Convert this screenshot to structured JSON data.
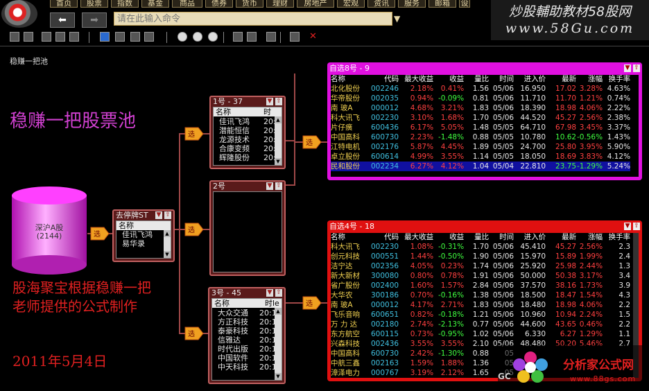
{
  "menubar": {
    "items": [
      "首页",
      "股票",
      "指数",
      "基金",
      "商品",
      "债券",
      "货币",
      "理财",
      "房地产",
      "宏观",
      "资讯",
      "服务",
      "邮箱",
      "设"
    ]
  },
  "nav": {
    "back_glyph": "⬅",
    "forward_glyph": "➡"
  },
  "command": {
    "placeholder": "请在此输入命令",
    "dropdown_glyph": "▼"
  },
  "brand": {
    "line1": "炒股輔助教材58股网",
    "line2": "www.58Gu.com"
  },
  "toolbar": {
    "icons": [
      "open-folder-icon",
      "folder-icon",
      "save-icon",
      "save-as-icon",
      "print-icon",
      "layout1-icon",
      "layout2-icon",
      "layout3-icon",
      "layout4-icon",
      "step-icon",
      "pause-icon",
      "stop-icon",
      "tool1-icon",
      "tool2-icon",
      "tool3-icon",
      "image-icon",
      "close-icon"
    ]
  },
  "canvas": {
    "title": "稳赚一把池",
    "heading": "稳赚一把股票池",
    "description": "股海聚宝根据稳赚一把老师提供的公式制作",
    "date": "2011年5月4日"
  },
  "source": {
    "line1": "深沪A股",
    "line2": "(2144)"
  },
  "filter_glyph": "选",
  "pool_filter": {
    "title": "去停牌ST",
    "column": "名称",
    "rows": [
      "佳讯飞鸿",
      "易华录"
    ]
  },
  "pool1": {
    "title": "1号 - 37",
    "column": "名称",
    "col2": "时",
    "rows": [
      [
        "佳讯飞鸿",
        "20:"
      ],
      [
        "潜能恒信",
        "20:"
      ],
      [
        "龙源技术",
        "20:"
      ],
      [
        "合康变频",
        "20:"
      ],
      [
        "辉隆股份",
        "20:"
      ]
    ]
  },
  "pool2": {
    "title": "2号"
  },
  "pool3": {
    "title": "3号 - 45",
    "column": "名称",
    "col2": "时le",
    "rows": [
      [
        "大众交通",
        "20:1"
      ],
      [
        "方正科技",
        "20:1"
      ],
      [
        "泰豪科技",
        "20:1"
      ],
      [
        "信雅达",
        "20:1"
      ],
      [
        "时代出版",
        "20:1"
      ],
      [
        "中国软件",
        "20:1"
      ],
      [
        "中天科技",
        "20:1"
      ]
    ]
  },
  "table_headers": [
    "名称",
    "代码",
    "最大收益",
    "收益",
    "量比",
    "时间",
    "进入价",
    "最新",
    "涨幅",
    "换手率"
  ],
  "table8": {
    "title": "自选8号 - 9",
    "rows": [
      {
        "name": "北化股份",
        "code": "002246",
        "max": "2.18%",
        "ret": "0.41%",
        "ratio": "1.56",
        "time": "05/06",
        "entry": "16.950",
        "last": "17.02",
        "chg": "3.28%",
        "turn": "4.63%",
        "retc": "red",
        "chgc": "red"
      },
      {
        "name": "华帝股份",
        "code": "002035",
        "max": "0.94%",
        "ret": "-0.09%",
        "ratio": "0.81",
        "time": "05/06",
        "entry": "11.710",
        "last": "11.70",
        "chg": "1.21%",
        "turn": "0.74%",
        "retc": "grn",
        "chgc": "red"
      },
      {
        "name": "南 玻A",
        "code": "000012",
        "max": "4.68%",
        "ret": "3.21%",
        "ratio": "1.83",
        "time": "05/06",
        "entry": "18.390",
        "last": "18.98",
        "chg": "4.06%",
        "turn": "2.22%",
        "retc": "red",
        "chgc": "red"
      },
      {
        "name": "科大讯飞",
        "code": "002230",
        "max": "3.10%",
        "ret": "1.68%",
        "ratio": "1.70",
        "time": "05/06",
        "entry": "44.520",
        "last": "45.27",
        "chg": "2.56%",
        "turn": "2.38%",
        "retc": "red",
        "chgc": "red"
      },
      {
        "name": "片仔癀",
        "code": "600436",
        "max": "6.17%",
        "ret": "5.05%",
        "ratio": "1.48",
        "time": "05/05",
        "entry": "64.710",
        "last": "67.98",
        "chg": "3.45%",
        "turn": "3.37%",
        "retc": "red",
        "chgc": "red"
      },
      {
        "name": "中国高科",
        "code": "600730",
        "max": "2.23%",
        "ret": "-1.48%",
        "ratio": "0.88",
        "time": "05/05",
        "entry": "10.780",
        "last": "10.62",
        "chg": "-0.56%",
        "turn": "1.43%",
        "retc": "grn",
        "chgc": "grn"
      },
      {
        "name": "江特电机",
        "code": "002176",
        "max": "5.87%",
        "ret": "4.45%",
        "ratio": "1.89",
        "time": "05/05",
        "entry": "24.700",
        "last": "25.80",
        "chg": "3.95%",
        "turn": "5.90%",
        "retc": "red",
        "chgc": "red"
      },
      {
        "name": "卓立股份",
        "code": "600614",
        "max": "4.99%",
        "ret": "3.55%",
        "ratio": "1.14",
        "time": "05/05",
        "entry": "18.050",
        "last": "18.69",
        "chg": "3.83%",
        "turn": "4.12%",
        "retc": "red",
        "chgc": "red"
      },
      {
        "name": "民和股份",
        "code": "002234",
        "max": "6.27%",
        "ret": "4.12%",
        "ratio": "1.04",
        "time": "05/04",
        "entry": "22.810",
        "last": "23.75",
        "chg": "-1.29%",
        "turn": "5.24%",
        "retc": "red",
        "chgc": "grn"
      }
    ]
  },
  "table4": {
    "title": "自选4号 - 18",
    "rows": [
      {
        "name": "科大讯飞",
        "code": "002230",
        "max": "1.08%",
        "ret": "-0.31%",
        "ratio": "1.70",
        "time": "05/06",
        "entry": "45.410",
        "last": "45.27",
        "chg": "2.56%",
        "turn": "2.3",
        "retc": "grn",
        "chgc": "red"
      },
      {
        "name": "创元科技",
        "code": "000551",
        "max": "1.44%",
        "ret": "-0.50%",
        "ratio": "1.90",
        "time": "05/06",
        "entry": "15.970",
        "last": "15.89",
        "chg": "1.99%",
        "turn": "2.4",
        "retc": "grn",
        "chgc": "red"
      },
      {
        "name": "洁宁达",
        "code": "002356",
        "max": "4.05%",
        "ret": "0.23%",
        "ratio": "1.74",
        "time": "05/06",
        "entry": "25.920",
        "last": "25.98",
        "chg": "2.44%",
        "turn": "1.3",
        "retc": "red",
        "chgc": "red"
      },
      {
        "name": "新大新材",
        "code": "300080",
        "max": "0.80%",
        "ret": "0.78%",
        "ratio": "1.91",
        "time": "05/06",
        "entry": "50.000",
        "last": "50.38",
        "chg": "3.17%",
        "turn": "3.4",
        "retc": "red",
        "chgc": "red"
      },
      {
        "name": "省广股份",
        "code": "002400",
        "max": "1.60%",
        "ret": "1.57%",
        "ratio": "2.84",
        "time": "05/06",
        "entry": "37.570",
        "last": "38.16",
        "chg": "1.73%",
        "turn": "3.9",
        "retc": "red",
        "chgc": "red"
      },
      {
        "name": "大华农",
        "code": "300186",
        "max": "0.70%",
        "ret": "-0.16%",
        "ratio": "1.38",
        "time": "05/06",
        "entry": "18.500",
        "last": "18.47",
        "chg": "1.54%",
        "turn": "4.3",
        "retc": "grn",
        "chgc": "red"
      },
      {
        "name": "南 玻A",
        "code": "000012",
        "max": "4.17%",
        "ret": "2.71%",
        "ratio": "1.83",
        "time": "05/06",
        "entry": "18.480",
        "last": "18.98",
        "chg": "4.06%",
        "turn": "2.2",
        "retc": "red",
        "chgc": "red"
      },
      {
        "name": "飞乐音响",
        "code": "600651",
        "max": "0.82%",
        "ret": "-0.18%",
        "ratio": "1.21",
        "time": "05/06",
        "entry": "10.960",
        "last": "10.94",
        "chg": "2.24%",
        "turn": "1.5",
        "retc": "grn",
        "chgc": "red"
      },
      {
        "name": "万 力 达",
        "code": "002180",
        "max": "2.74%",
        "ret": "-2.13%",
        "ratio": "0.77",
        "time": "05/06",
        "entry": "44.600",
        "last": "43.65",
        "chg": "0.46%",
        "turn": "2.2",
        "retc": "grn",
        "chgc": "red"
      },
      {
        "name": "东方航空",
        "code": "600115",
        "max": "0.73%",
        "ret": "-0.95%",
        "ratio": "1.02",
        "time": "05/06",
        "entry": "6.330",
        "last": "6.27",
        "chg": "1.29%",
        "turn": "1.1",
        "retc": "grn",
        "chgc": "red"
      },
      {
        "name": "兴森科技",
        "code": "002436",
        "max": "3.55%",
        "ret": "3.55%",
        "ratio": "2.10",
        "time": "05/06",
        "entry": "48.480",
        "last": "50.20",
        "chg": "5.46%",
        "turn": "2.7",
        "retc": "red",
        "chgc": "red"
      },
      {
        "name": "中国高科",
        "code": "600730",
        "max": "2.42%",
        "ret": "-1.30%",
        "ratio": "0.88",
        "time": "05",
        "entry": "",
        "last": "",
        "chg": "",
        "turn": "",
        "retc": "grn",
        "chgc": "red"
      },
      {
        "name": "中航三鑫",
        "code": "002163",
        "max": "1.59%",
        "ret": "1.88%",
        "ratio": "1.36",
        "time": "05",
        "entry": "",
        "last": "",
        "chg": "",
        "turn": "",
        "retc": "red",
        "chgc": "red"
      },
      {
        "name": "漳泽电力",
        "code": "000767",
        "max": "3.19%",
        "ret": "2.12%",
        "ratio": "1.65",
        "time": "05",
        "entry": "",
        "last": "",
        "chg": "",
        "turn": "",
        "retc": "red",
        "chgc": "red"
      }
    ]
  },
  "watermark": {
    "site_name": "分析家公式网",
    "site_url": "www.88gs.com",
    "partial": "GC"
  }
}
